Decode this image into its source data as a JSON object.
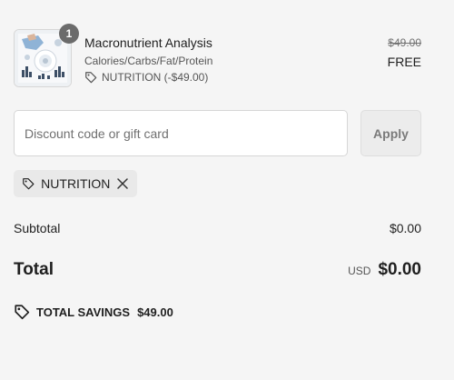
{
  "line_item": {
    "quantity": "1",
    "title": "Macronutrient Analysis",
    "variant": "Calories/Carbs/Fat/Protein",
    "discount_allocation": "NUTRITION (-$49.00)",
    "original_price": "$49.00",
    "final_price": "FREE",
    "thumbnail_icon": "product-image"
  },
  "discount_form": {
    "placeholder": "Discount code or gift card",
    "value": "",
    "apply_label": "Apply"
  },
  "applied_discount": {
    "code": "NUTRITION",
    "tag_icon": "tag-icon",
    "remove_icon": "close-icon"
  },
  "totals": {
    "subtotal_label": "Subtotal",
    "subtotal_value": "$0.00",
    "total_label": "Total",
    "currency": "USD",
    "total_value": "$0.00",
    "savings_label": "TOTAL SAVINGS",
    "savings_value": "$49.00"
  },
  "colors": {
    "background": "#f5f5f5",
    "badge": "#6b6b6b",
    "apply_button_bg": "#ececec",
    "tag_bg": "#e9e9e9"
  }
}
